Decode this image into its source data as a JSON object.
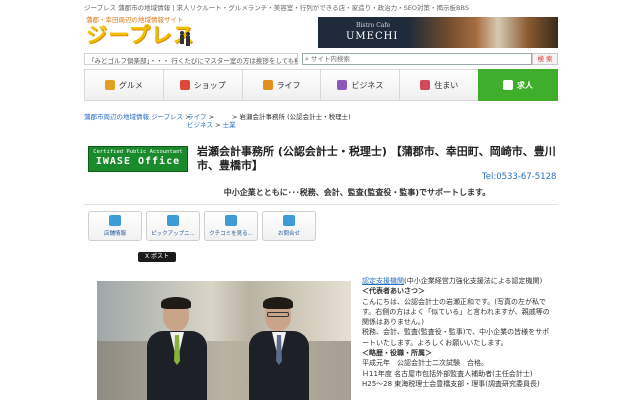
{
  "header": {
    "top_links": "ジープレス 蒲郡市の地域情報 | 求人リクルート・グルメランチ・美容室・行列ができる店・家造り・政治力・SEO対策・揭示板BBS",
    "logo_tagline": "蒲郡・幸田周辺の地域情報サイト",
    "logo_brand": "ジープレス",
    "banner_line1": "Bistro Cafe",
    "banner_line2": "UMECHI",
    "ticker": "「みどゴルフ倶楽部」・・・ 行くたびにマスター室の方は挨拶をしても無視。無常態で全くもって失礼",
    "search_placeholder": "サイト内検索",
    "search_button": "検 索"
  },
  "nav": {
    "items": [
      {
        "label": "グルメ",
        "icon": "chopsticks-icon",
        "color": "#e0a020"
      },
      {
        "label": "ショップ",
        "icon": "shopping-bag-icon",
        "color": "#e04a3a"
      },
      {
        "label": "ライフ",
        "icon": "person-icon",
        "color": "#e09020"
      },
      {
        "label": "ビジネス",
        "icon": "building-icon",
        "color": "#8a5ab8"
      },
      {
        "label": "住まい",
        "icon": "house-icon",
        "color": "#d04a5a"
      },
      {
        "label": "求人",
        "icon": "job-person-icon",
        "color": "#ffffff"
      }
    ],
    "active_index": 5
  },
  "breadcrumb": {
    "home": "蒲郡市周辺の地域情報 ジープレス",
    "sep": ">",
    "life": "ライフ",
    "business": "ビジネス",
    "zen": "士業",
    "current": "岩瀬会計事務所 (公認会計士・税理士)"
  },
  "company": {
    "logo_line1": "Certified Public Accountant",
    "logo_line2": "IWASE Office",
    "title": "岩瀬会計事務所 (公認会計士・税理士) 【蒲郡市、幸田町、岡崎市、豊川市、豊橋市】",
    "tel": "Tel:0533-67-5128",
    "tagline": "中小企業とともに･･･税務、会計、監査(監査役・監事)でサポートします。"
  },
  "actions": [
    {
      "label": "店舗情報",
      "icon": "store-info-icon"
    },
    {
      "label": "ピックアップニ...",
      "icon": "megaphone-icon"
    },
    {
      "label": "クチコミを見る...",
      "icon": "speech-bubble-icon"
    },
    {
      "label": "お問合せ",
      "icon": "mail-icon"
    }
  ],
  "tweet_button": "X ポスト",
  "bio": {
    "link_text": "認定支援機関",
    "line1_rest": "(中小企業経営力強化支援法による認定機関)",
    "heading1": "＜代表者あいさつ＞",
    "greeting": [
      "こんにちは、公認会計士の岩瀬正和です。(写真の左が私で",
      "す。右側の方はよく「似ている」と言われますが、親戚等の",
      "関係はありません。)",
      "税務、会計、監査(監査役・監事)で、中小企業の皆様をサポ",
      "ートいたします。よろしくお願いいたします。"
    ],
    "heading2": "＜略歴・役職・所属＞",
    "history": [
      "平成元年　公認会計士二次試験　合格。",
      "Ｈ11年度 名古屋市包括外部監査人補助者(主任会計士)",
      "H25～28 東海税理士会豊橋支部・理事(調査研究委員長)"
    ]
  }
}
